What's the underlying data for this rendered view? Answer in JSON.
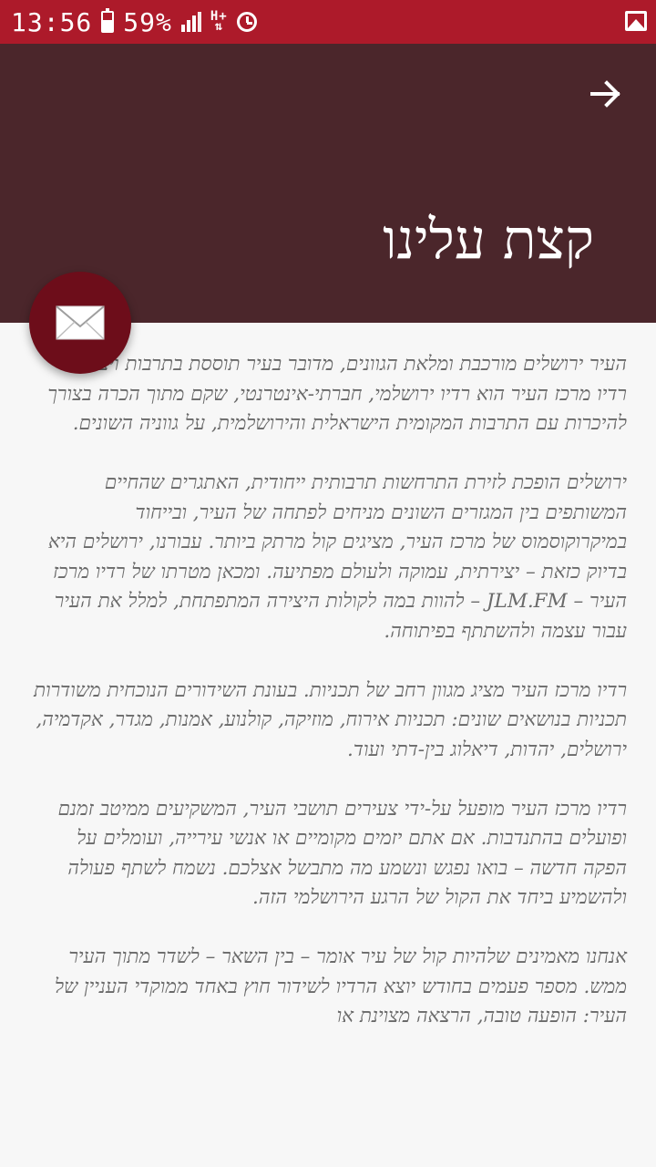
{
  "status_bar": {
    "time": "13:56",
    "battery_level": 0.59,
    "battery_percent": "59%",
    "network": "H+",
    "icons": [
      "battery-icon",
      "signal-icon",
      "network-hplus-icon",
      "alarm-icon",
      "image-notification-icon"
    ]
  },
  "header": {
    "title": "קצת עלינו",
    "back_icon": "arrow-icon",
    "background": "#4b262b"
  },
  "fab": {
    "icon": "mail-icon",
    "color": "#6d0d1a"
  },
  "content": {
    "paragraphs": [
      "העיר ירושלים מורכבת ומלאת הגוונים, מדובר בעיר תוססת בתרבות ויצירה. רדיו מרכז העיר הוא רדיו ירושלמי, חברתי-אינטרנטי, שקם מתוך הכרה בצורך להיכרות עם התרבות המקומית הישראלית והירושלמית, על גווניה השונים.",
      "ירושלים הופכת לזירת התרחשות תרבותית ייחודית, האתגרים שהחיים המשותפים בין המגזרים השונים מניחים לפתחה של העיר, ובייחוד במיקרוקוסמוס של מרכז העיר, מציגים קול מרתק ביותר. עבורנו, ירושלים היא בדיוק כזאת – יצירתית, עמוקה ולעולם מפתיעה. ומכאן מטרתו של רדיו מרכז העיר – JLM.FM – להוות במה לקולות היצירה המתפתחת, למלל את העיר עבור עצמה ולהשתתף בפיתוחה.",
      "רדיו מרכז העיר מציג מגוון רחב של תכניות. בעונת השידורים הנוכחית משודרות תכניות בנושאים שונים: תכניות אירוח, מוזיקה, קולנוע, אמנות, מגדר, אקדמיה, ירושלים, יהדות, דיאלוג בין-דתי ועוד.",
      "רדיו מרכז העיר מופעל על-ידי צעירים תושבי העיר, המשקיעים ממיטב זמנם ופועלים בהתנדבות. אם אתם יזמים מקומיים או אנשי עירייה, ועומלים על הפקה חדשה – בואו נפגש ונשמע מה מתבשל אצלכם. נשמח לשתף פעולה ולהשמיע ביחד את הקול של הרגע הירושלמי הזה.",
      "אנחנו מאמינים שלהיות קול של עיר אומר – בין השאר – לשדר מתוך העיר ממש. מספר פעמים בחודש יוצא הרדיו לשידור חוץ באחד ממוקדי העניין של העיר: הופעה טובה, הרצאה מצוינת או"
    ]
  }
}
